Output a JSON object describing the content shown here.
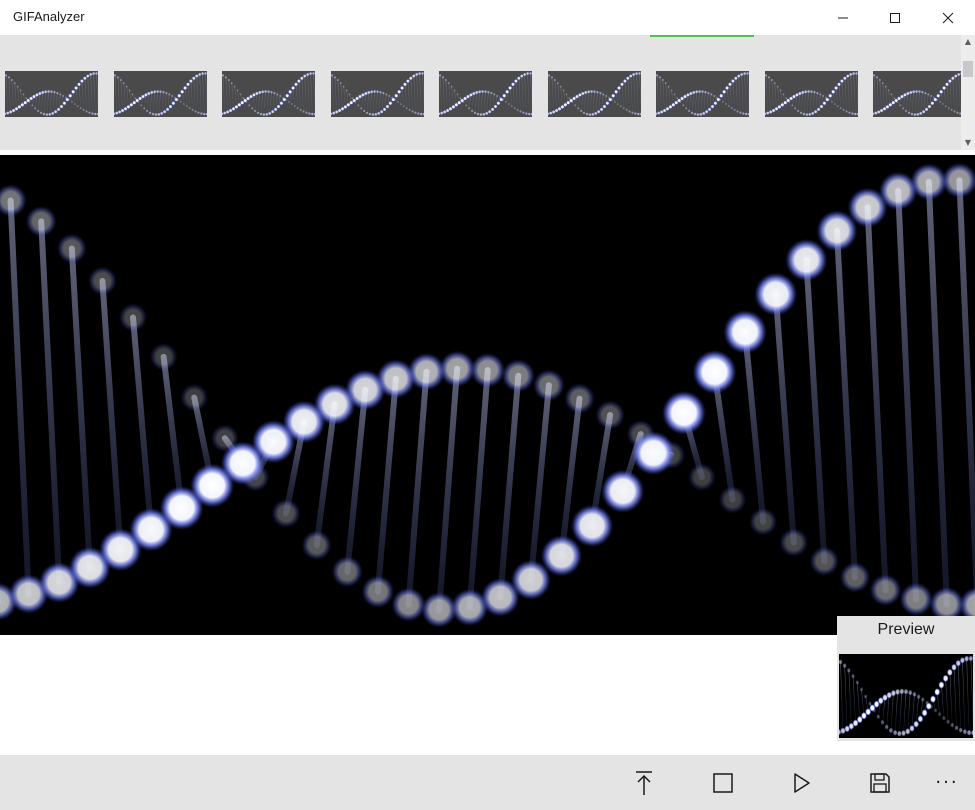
{
  "window": {
    "title": "GIFAnalyzer",
    "minimize_glyph": "—",
    "maximize_glyph": "☐",
    "close_glyph": "✕"
  },
  "thumbnails": {
    "count": 9,
    "active_index": 6,
    "indicator_color": "#4fc152"
  },
  "scrollbar": {
    "up_glyph": "▲",
    "down_glyph": "▼"
  },
  "preview": {
    "label": "Preview"
  },
  "commands": {
    "upload_icon": "upload-icon",
    "stop_icon": "stop-icon",
    "play_icon": "play-icon",
    "save_icon": "save-icon",
    "more_label": "···"
  },
  "colors": {
    "chrome": "#e4e4e4",
    "frame_bg": "#000000",
    "dot_glow": "#7f8cff"
  }
}
